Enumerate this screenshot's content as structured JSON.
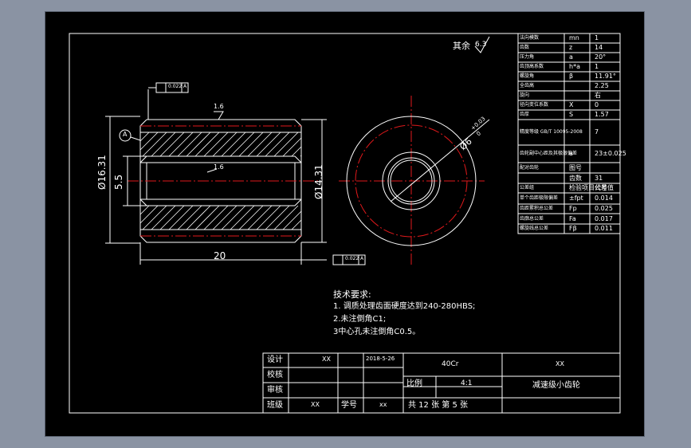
{
  "surface_finish_note": "其余",
  "surface_finish_value": "6.3",
  "surface_finish_inner": "1.6",
  "tolerance_tag_top": {
    "value": "0.022",
    "datum": "A"
  },
  "tolerance_tag_bottom": {
    "value": "0.022",
    "datum": "A"
  },
  "datum_label": "A",
  "dimensions": {
    "outer_diameter": "Ø16.31",
    "inner_diameter": "Ø14.31",
    "bore": "5.5",
    "length": "20",
    "bore_diameter_mark": "Ø6",
    "bore_tol_upper": "+0.03",
    "bore_tol_lower": "0"
  },
  "param_table": [
    {
      "name": "法向模数",
      "sym": "mn",
      "val": "1"
    },
    {
      "name": "齿数",
      "sym": "z",
      "val": "14"
    },
    {
      "name": "压力角",
      "sym": "a",
      "val": "20°"
    },
    {
      "name": "齿顶高系数",
      "sym": "h*a",
      "val": "1"
    },
    {
      "name": "螺旋角",
      "sym": "β",
      "val": "11.91°"
    },
    {
      "name": "全齿高",
      "sym": "",
      "val": "2.25"
    },
    {
      "name": "旋向",
      "sym": "",
      "val": "右"
    },
    {
      "name": "径向变位系数",
      "sym": "X",
      "val": "0"
    },
    {
      "name": "齿厚",
      "sym": "S",
      "val": "1.57"
    },
    {
      "name": "精度等级 GB/T 10095-2008",
      "sym": "",
      "val": "7"
    },
    {
      "name": "齿轮副中心距及其极限偏差",
      "sym": "a",
      "val": "23±0.025"
    },
    {
      "name": "配对齿轮",
      "sym": "图号",
      "val": ""
    },
    {
      "name": "",
      "sym": "齿数",
      "val": "31"
    },
    {
      "name": "公差组",
      "sym": "检验项目代号",
      "val": "公差值"
    },
    {
      "name": "单个齿距极限偏差",
      "sym": "±fpt",
      "val": "0.014"
    },
    {
      "name": "齿距累积总公差",
      "sym": "Fp",
      "val": "0.025"
    },
    {
      "name": "齿廓总公差",
      "sym": "Fa",
      "val": "0.017"
    },
    {
      "name": "螺旋线总公差",
      "sym": "Fβ",
      "val": "0.011"
    }
  ],
  "tech_requirements": {
    "title": "技术要求:",
    "items": [
      "1. 调质处理齿面硬度达到240-280HBS;",
      "2.未注倒角C1;",
      "3中心孔未注倒角C0.5。"
    ]
  },
  "title_block": {
    "design_label": "设计",
    "designer": "XX",
    "date": "2018-5-26",
    "material": "40Cr",
    "company": "XX",
    "check_label": "校核",
    "review_label": "审核",
    "class_label": "班级",
    "class_value": "XX",
    "id_label": "学号",
    "id_value": "xx",
    "scale_label": "比例",
    "scale_value": "4:1",
    "part_name": "减速级小齿轮",
    "sheet_info": "共 12 张 第 5 张"
  }
}
